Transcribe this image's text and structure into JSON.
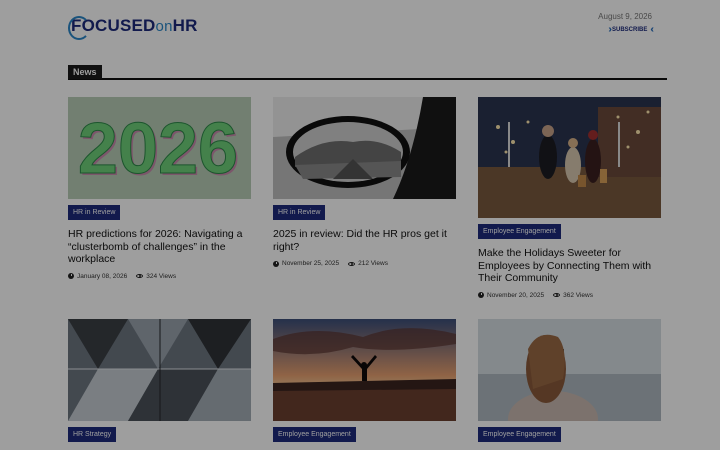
{
  "header": {
    "logo_focused": "FOCUSED",
    "logo_on": "on",
    "logo_hr": "HR",
    "date": "August 9, 2026",
    "subscribe": "SUBSCRIBE"
  },
  "section": {
    "title": "News"
  },
  "articles": [
    {
      "category": "HR in Review",
      "title": "HR predictions for 2026: Navigating a “clusterbomb of challenges” in the workplace",
      "date": "January 08, 2026",
      "views": "324 Views",
      "image": "2026-green-number-image"
    },
    {
      "category": "HR in Review",
      "title": "2025 in review: Did the HR pros get it right?",
      "date": "November 25, 2025",
      "views": "212 Views",
      "image": "car-side-mirror-image"
    },
    {
      "category": "Employee Engagement",
      "title": "Make the Holidays Sweeter for Employees by Connecting Them with Their Community",
      "date": "November 20, 2025",
      "views": "362 Views",
      "image": "holiday-shoppers-street-image"
    },
    {
      "category": "HR Strategy",
      "image": "mirrored-geometric-image"
    },
    {
      "category": "Employee Engagement",
      "image": "sunset-silhouette-image"
    },
    {
      "category": "Employee Engagement",
      "image": "woman-on-phone-beach-image"
    }
  ],
  "colors": {
    "brand": "#1d2b7c",
    "accent": "#2a87c8",
    "overlay": "rgba(0,0,0,0.38)"
  }
}
